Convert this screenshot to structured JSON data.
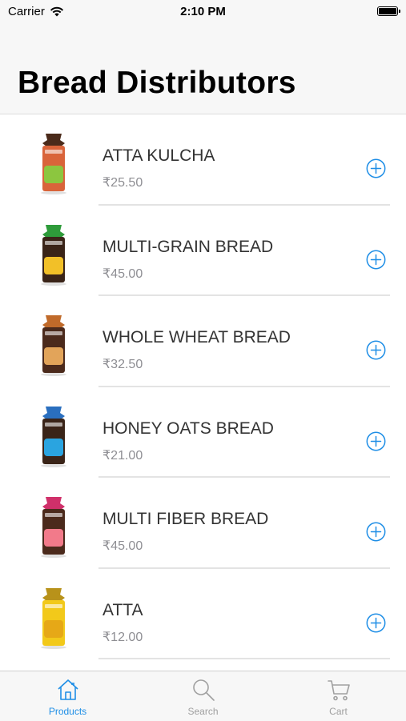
{
  "status": {
    "carrier": "Carrier",
    "time": "2:10 PM"
  },
  "header": {
    "title": "Bread Distributors"
  },
  "products": [
    {
      "name": "ATTA KULCHA",
      "price": "₹25.50",
      "colors": {
        "top": "#4a2a1a",
        "body": "#d9643a",
        "accent": "#8cc63f"
      }
    },
    {
      "name": "MULTI-GRAIN BREAD",
      "price": "₹45.00",
      "colors": {
        "top": "#2e9b3a",
        "body": "#3a2418",
        "accent": "#f2c028"
      }
    },
    {
      "name": "WHOLE WHEAT BREAD",
      "price": "₹32.50",
      "colors": {
        "top": "#c06a2a",
        "body": "#4b2a1c",
        "accent": "#e2a45a"
      }
    },
    {
      "name": "HONEY OATS BREAD",
      "price": "₹21.00",
      "colors": {
        "top": "#2a6fbf",
        "body": "#3a2418",
        "accent": "#2aa4e0"
      }
    },
    {
      "name": "MULTI FIBER BREAD",
      "price": "₹45.00",
      "colors": {
        "top": "#d0306a",
        "body": "#4b2a1c",
        "accent": "#f27a8a"
      }
    },
    {
      "name": "ATTA",
      "price": "₹12.00",
      "colors": {
        "top": "#b8921a",
        "body": "#f2c91a",
        "accent": "#e6a817"
      }
    }
  ],
  "tabs": [
    {
      "label": "Products",
      "active": true,
      "icon": "house-icon"
    },
    {
      "label": "Search",
      "active": false,
      "icon": "magnifier-icon"
    },
    {
      "label": "Cart",
      "active": false,
      "icon": "cart-icon"
    }
  ],
  "theme": {
    "accent": "#1e8ee6",
    "inactive": "#a0a0a0"
  }
}
